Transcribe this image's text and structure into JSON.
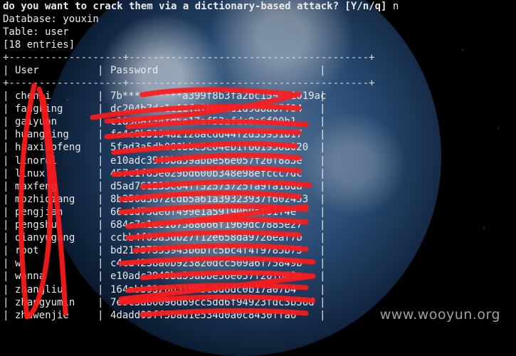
{
  "prompt": {
    "question": "do you want to crack them via a dictionary-based attack? [Y/n/q]",
    "answer": "n"
  },
  "info": {
    "database_line": "Database: youxin",
    "table_line": "Table: user",
    "entries_line": "[18 entries]"
  },
  "table": {
    "border": "+-------------------+----------------------------------------+",
    "headers": {
      "user": "User",
      "password": "Password"
    },
    "rows": [
      {
        "user": "chenli",
        "password": "7b**********a399f8b3fa2bc159531019ac"
      },
      {
        "user": "fangking",
        "password": "dc204b7dc1e16fa7b8cdd1d9d8a67f04"
      },
      {
        "user": "gaiyuan",
        "password": "c1898a134fd6e17af53afdc8e6f00b1"
      },
      {
        "user": "huangting",
        "password": "fc4c0b3194a2128acdd44f2d35931b17"
      },
      {
        "user": "huaxiaofeng",
        "password": "5fad3a5db000bbe5e04eb1f661930a020"
      },
      {
        "user": "linorui",
        "password": "e10adc3949ba59abbe56e057f20f883e"
      },
      {
        "user": "linux",
        "password": "457c1f83e029bd600b348e98efccc7dc"
      },
      {
        "user": "maxfeng",
        "password": "d5ad761233e04ff52573725fa9fa18da"
      },
      {
        "user": "mozhiqiang",
        "password": "8b250d5872cdb5a61a39323937f602453"
      },
      {
        "user": "pengjian",
        "password": "66edd73de6f499e1a59190b0af91f4e"
      },
      {
        "user": "pengshu",
        "password": "684c7a1ee187588666f1969dc7885e27"
      },
      {
        "user": "qianyugang",
        "password": "ccbb4f03a3db27f12e658da9726eaf7b"
      },
      {
        "user": "root",
        "password": "bd21797553943b6bfc5bc4f4f9785b75"
      },
      {
        "user": "w",
        "password": "c4ca4238a0b923820dcc509a6f75849b"
      },
      {
        "user": "wanna",
        "password": "e10adc3949ba59abbe56e057f20f883e"
      },
      {
        "user": "zhangliu",
        "password": "164abb9320b31995c8d6dc0b17a07b4"
      },
      {
        "user": "zhangyumin",
        "password": "7e9c3ab0096d69cc5dd6f94923fdc3b56d"
      },
      {
        "user": "zhuwenjie",
        "password": "4dadd09ff5bad1e534d0a0c8430ffa6"
      }
    ]
  },
  "watermark": "www.wooyun.org",
  "colors": {
    "scribble": "#ff1a1a",
    "text": "#e9e9e9",
    "background": "#000000"
  }
}
